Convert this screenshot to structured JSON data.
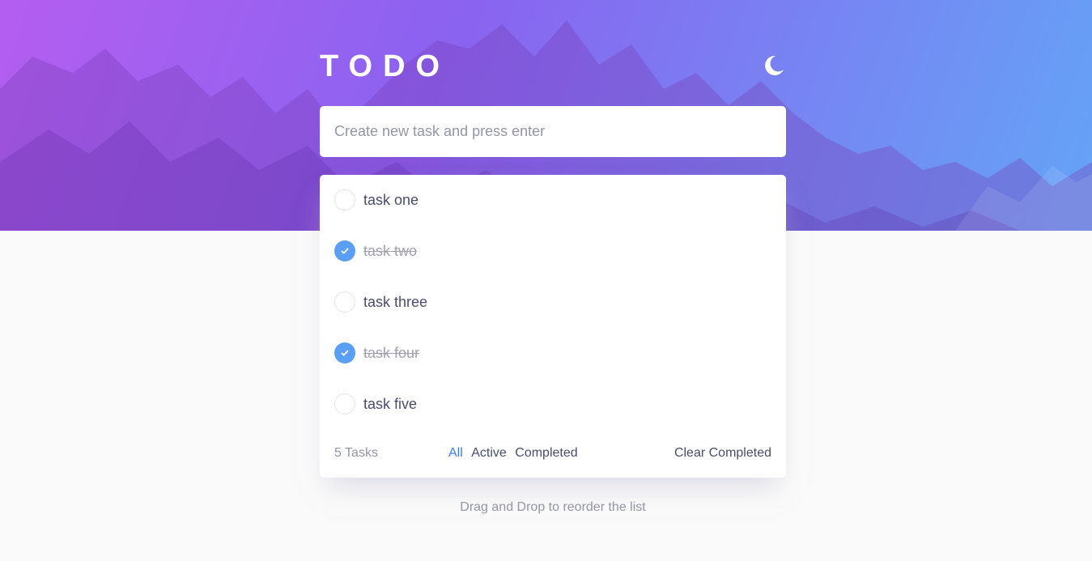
{
  "app": {
    "title": "TODO"
  },
  "theme": {
    "toggle_icon": "moon-icon",
    "accent_color": "#3a7cfd",
    "check_color": "#5a9ef5"
  },
  "new_task": {
    "placeholder": "Create new task and press enter",
    "value": ""
  },
  "tasks": [
    {
      "label": "task one",
      "completed": false
    },
    {
      "label": "task two",
      "completed": true
    },
    {
      "label": "task three",
      "completed": false
    },
    {
      "label": "task four",
      "completed": true
    },
    {
      "label": "task five",
      "completed": false
    }
  ],
  "footer": {
    "count_label": "5 Tasks",
    "filters": [
      {
        "label": "All",
        "active": true
      },
      {
        "label": "Active",
        "active": false
      },
      {
        "label": "Completed",
        "active": false
      }
    ],
    "clear_label": "Clear Completed"
  },
  "hint": "Drag and Drop to reorder the list"
}
